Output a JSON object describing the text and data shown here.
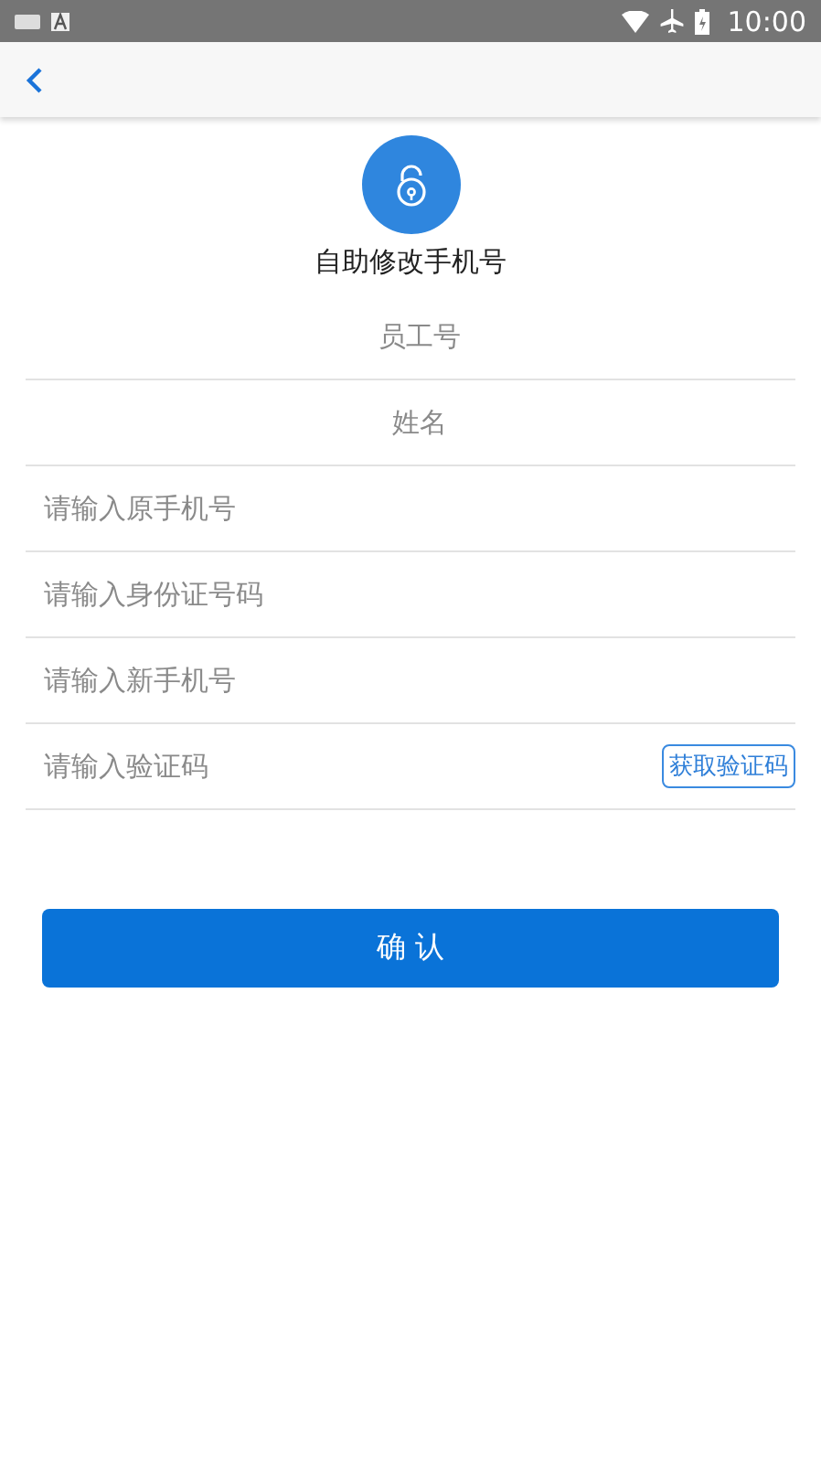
{
  "status_bar": {
    "time": "10:00"
  },
  "header": {
    "title": "自助修改手机号"
  },
  "fields": [
    {
      "kind": "center",
      "placeholder": "员工号"
    },
    {
      "kind": "center",
      "placeholder": "姓名"
    },
    {
      "kind": "left",
      "placeholder": "请输入原手机号"
    },
    {
      "kind": "left",
      "placeholder": "请输入身份证号码"
    },
    {
      "kind": "left",
      "placeholder": "请输入新手机号"
    },
    {
      "kind": "code",
      "placeholder": "请输入验证码",
      "action": "获取验证码"
    }
  ],
  "confirm_button": "确 认"
}
